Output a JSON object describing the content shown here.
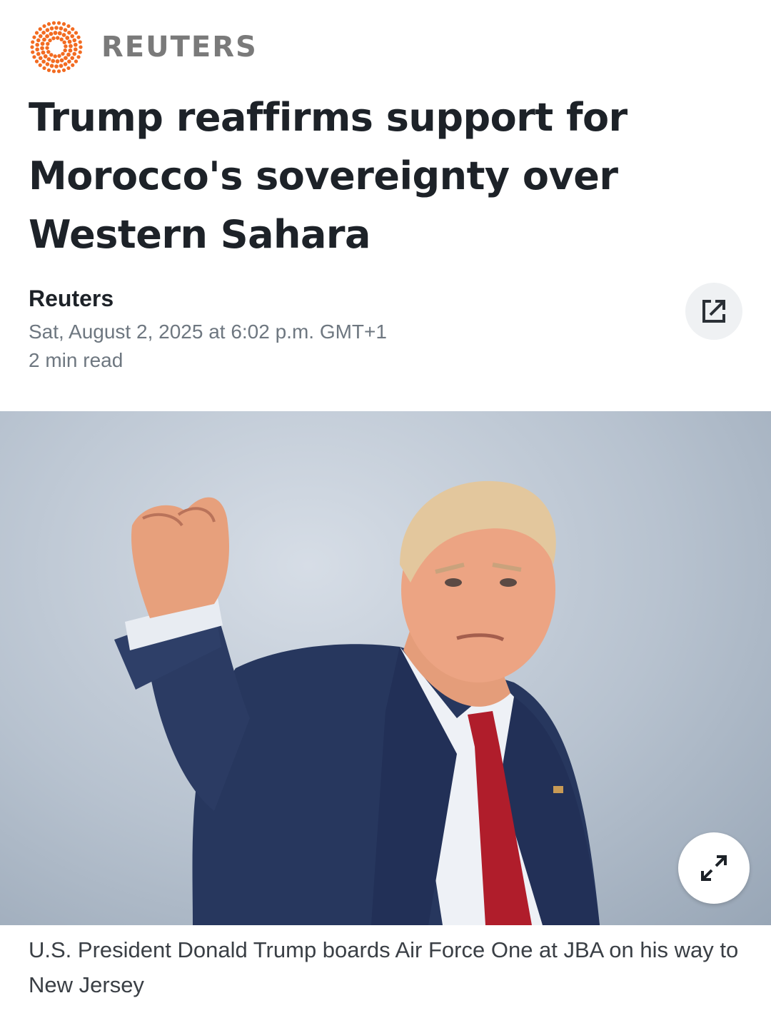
{
  "publisher": {
    "logo_text": "REUTERS",
    "logo_icon": "reuters-dot-ring-logo",
    "brand_color": "#f26b21"
  },
  "article": {
    "headline": "Trump reaffirms support for Morocco's sovereignty over Western Sahara",
    "source": "Reuters",
    "date": "Sat, August 2, 2025 at 6:02 p.m. GMT+1",
    "read_time": "2 min read"
  },
  "actions": {
    "share_icon": "external-share-icon",
    "expand_icon": "expand-arrows-icon"
  },
  "hero_image": {
    "subject": "man in navy suit and red tie raising fist against grey sky",
    "caption": "U.S. President Donald Trump boards Air Force One at JBA on his way to New Jersey"
  },
  "colors": {
    "text_primary": "#1d2228",
    "text_secondary": "#6e7780",
    "button_bg": "#eff1f3"
  }
}
